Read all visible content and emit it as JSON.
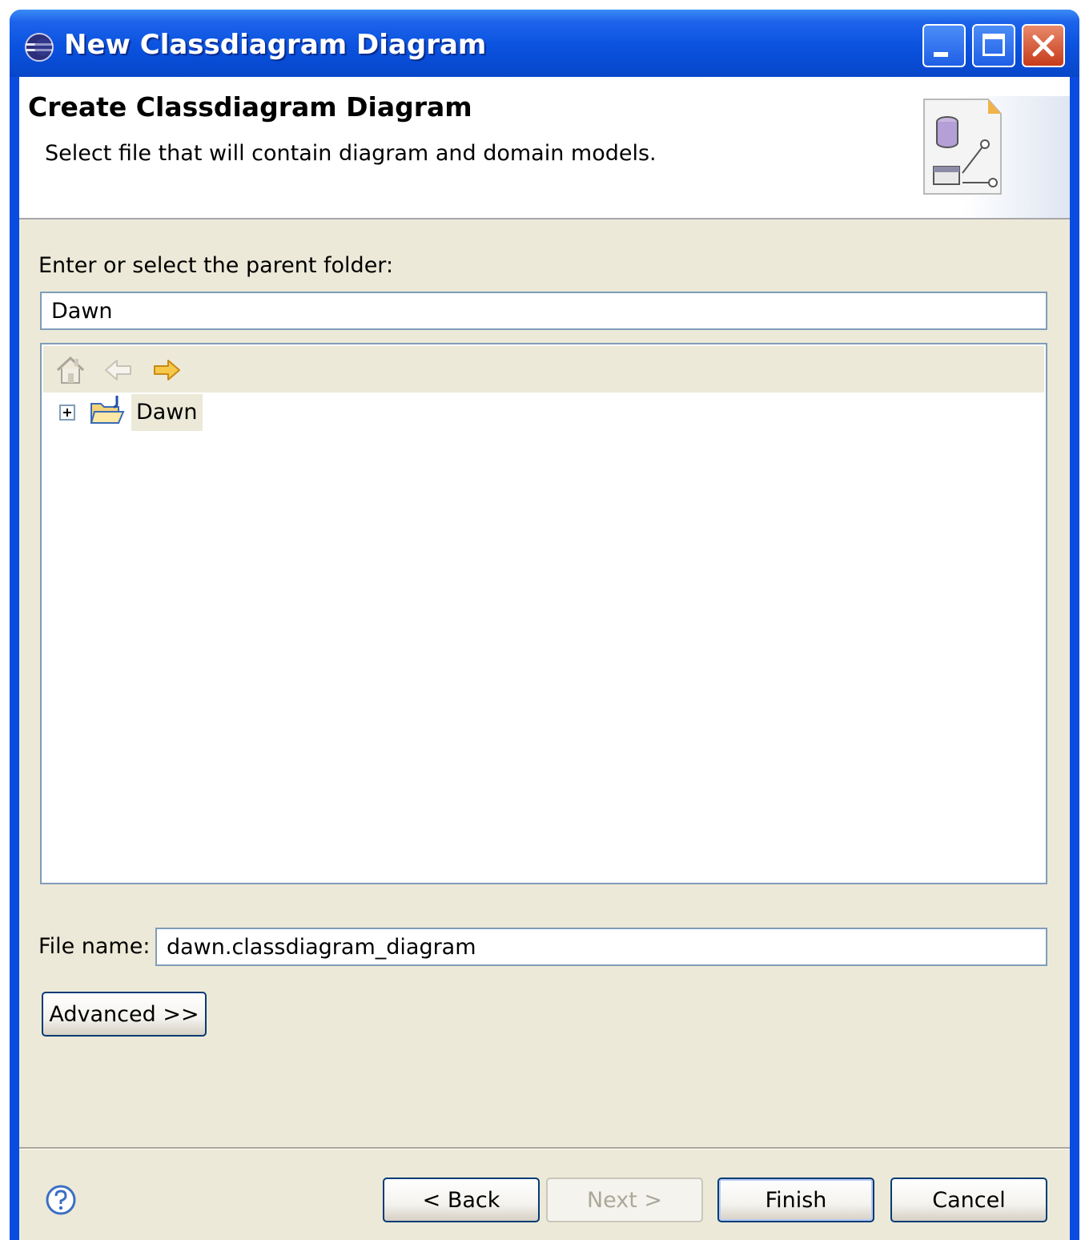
{
  "window": {
    "title": "New Classdiagram Diagram",
    "controls": [
      "minimize-icon",
      "maximize-icon",
      "close-icon"
    ]
  },
  "header": {
    "title": "Create Classdiagram Diagram",
    "description": "Select file that will contain diagram and domain models."
  },
  "folder": {
    "label": "Enter or select the parent folder:",
    "value": "Dawn"
  },
  "tree": {
    "toolbar_icons": [
      "home-icon",
      "back-arrow-icon",
      "forward-arrow-icon"
    ],
    "items": [
      {
        "label": "Dawn",
        "expanded": false,
        "icon": "project-folder-icon"
      }
    ]
  },
  "file": {
    "label": "File name:",
    "value": "dawn.classdiagram_diagram"
  },
  "buttons": {
    "advanced": "Advanced >>",
    "back": "< Back",
    "next": "Next >",
    "finish": "Finish",
    "cancel": "Cancel"
  },
  "colors": {
    "title_bar": "#0a52df",
    "dialog_bg": "#ece9d8",
    "border": "#7f9db9"
  }
}
